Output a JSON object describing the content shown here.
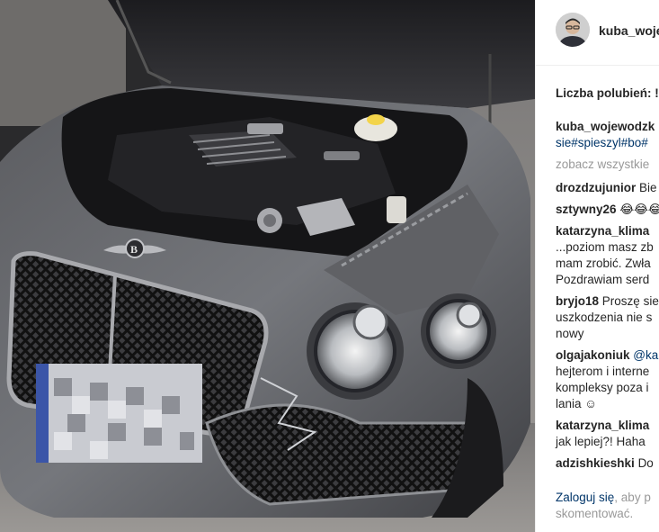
{
  "post": {
    "username": "kuba_woje",
    "likes_label": "Liczba polubień: !",
    "caption_user": "kuba_wojewodzk",
    "caption_tags": "sie#spieszyl#bo#",
    "view_all": "zobacz wszystkie",
    "license_plate": "XXXXXXX"
  },
  "comments": [
    {
      "user": "drozdzujunior",
      "lines": [
        "Bie"
      ]
    },
    {
      "user": "sztywny26",
      "lines": [
        "😂😂😂"
      ]
    },
    {
      "user": "katarzyna_klima",
      "lines": [
        "...poziom masz zb",
        "mam zrobić. Zwła",
        "Pozdrawiam serd"
      ]
    },
    {
      "user": "bryjo18",
      "lines": [
        "Proszę sie",
        "uszkodzenia nie s",
        "nowy"
      ]
    },
    {
      "user": "olgajakoniuk",
      "mention": "@ka",
      "lines": [
        "hejterom i interne",
        "kompleksy poza i",
        "lania ☺"
      ]
    },
    {
      "user": "katarzyna_klima",
      "lines": [
        "jak lepiej?! Haha"
      ]
    },
    {
      "user": "adzishkieshki",
      "lines": [
        "Do"
      ]
    }
  ],
  "footer": {
    "login_link": "Zaloguj się",
    "text_after": ", aby p",
    "line2": "skomentować."
  },
  "colors": {
    "link": "#003569",
    "muted": "#999999",
    "text": "#262626"
  }
}
